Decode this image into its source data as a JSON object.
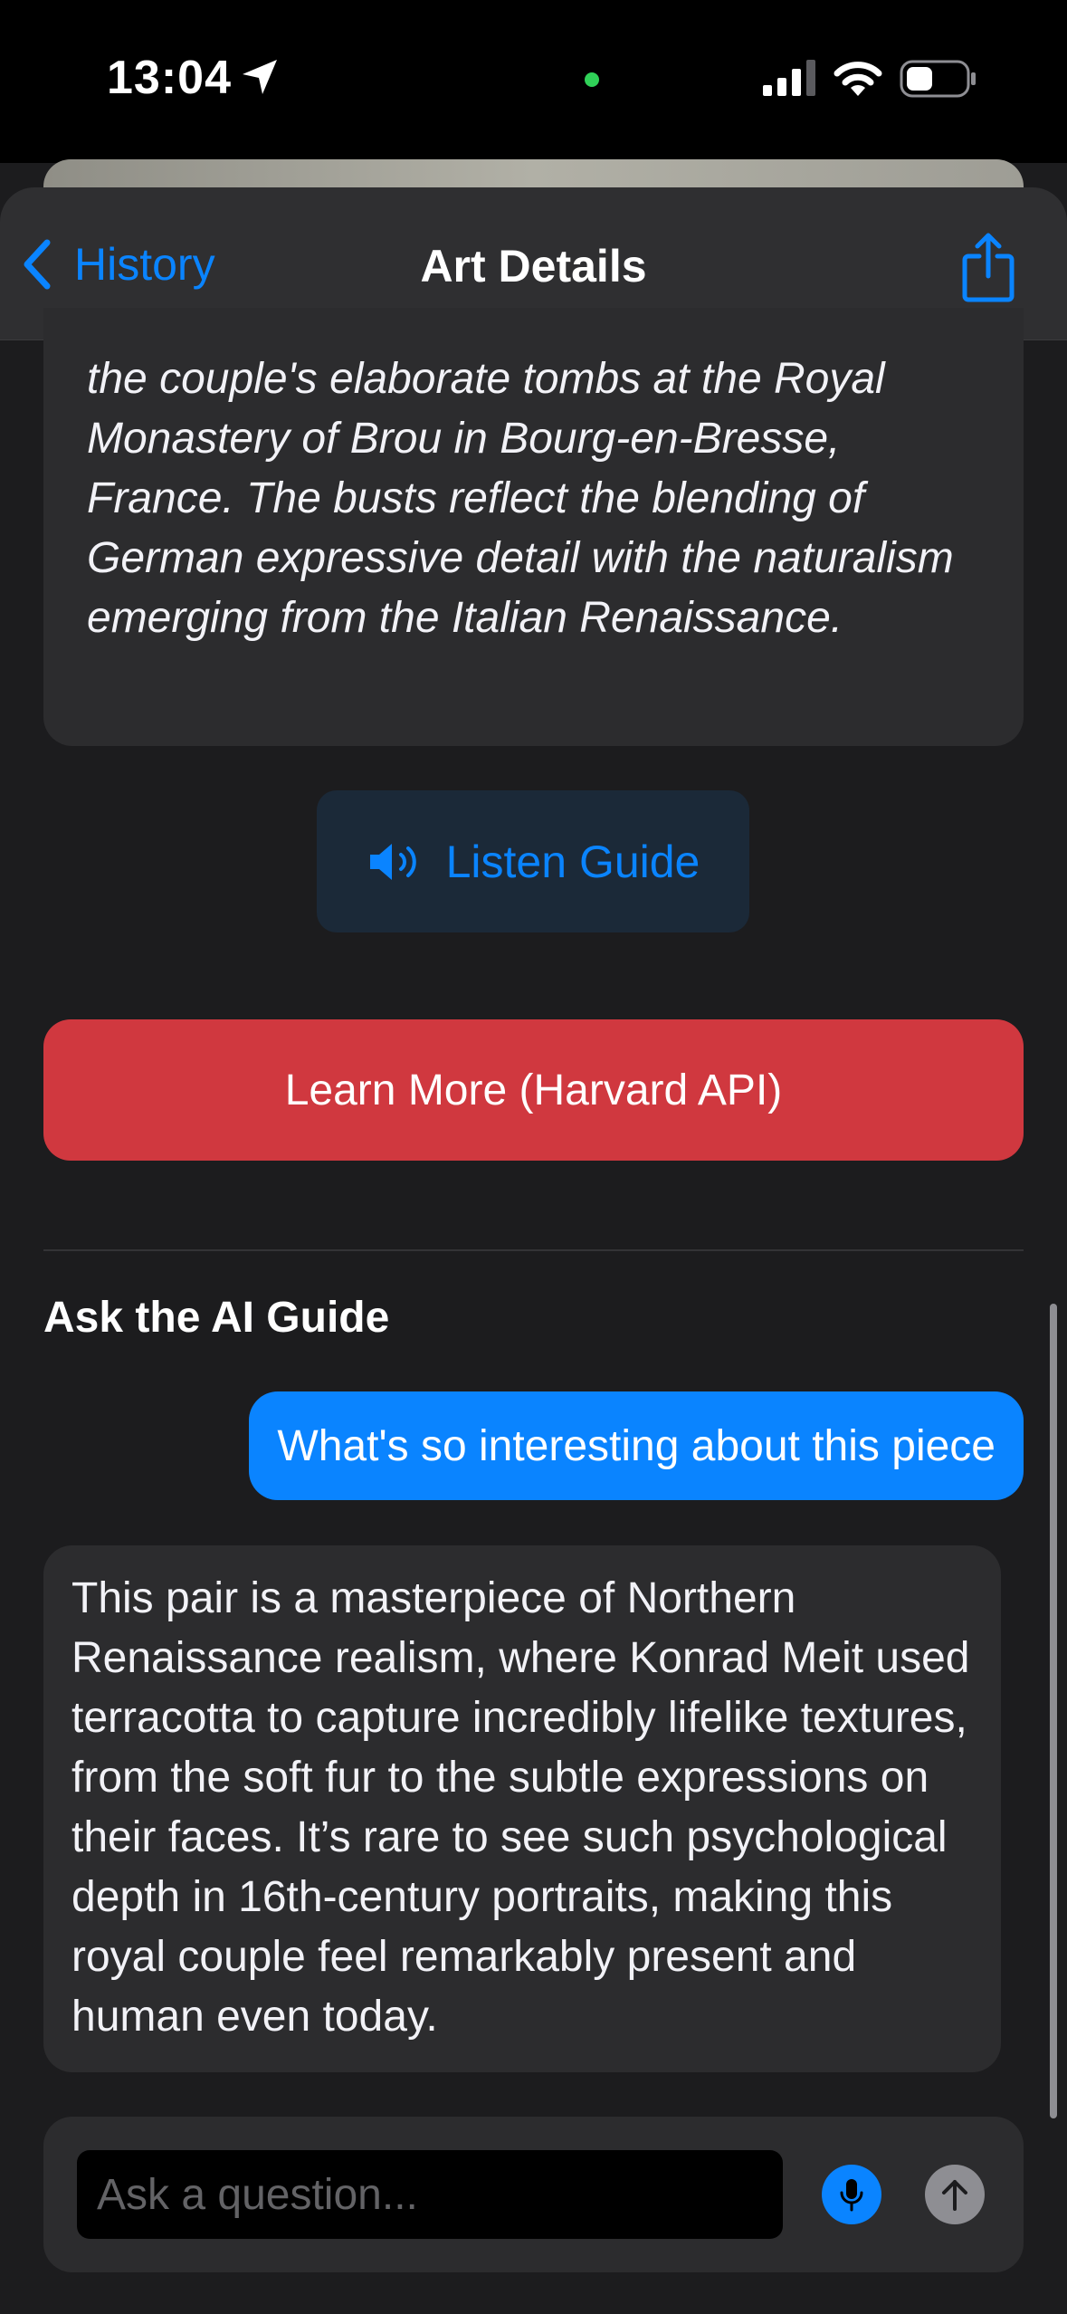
{
  "status_bar": {
    "time": "13:04",
    "location_icon": "location-arrow-icon",
    "signal_icon": "cellular-signal-icon",
    "wifi_icon": "wifi-icon",
    "battery_icon": "battery-icon",
    "recording_dot_color": "#30d158"
  },
  "nav": {
    "back_label": "History",
    "title": "Art Details",
    "share_icon": "share-icon"
  },
  "description": {
    "text": "the couple's elaborate tombs at the Royal Monastery of Brou in Bourg-en-Bresse, France. The busts reflect the blending of German expressive detail with the naturalism emerging from the Italian Renaissance."
  },
  "actions": {
    "listen_label": "Listen Guide",
    "learn_more_label": "Learn More (Harvard API)"
  },
  "chat": {
    "section_title": "Ask the AI Guide",
    "messages": [
      {
        "role": "user",
        "text": "What's so interesting about this piece"
      },
      {
        "role": "assistant",
        "text": "This pair is a masterpiece of Northern Renaissance realism, where Konrad Meit used terracotta to capture incredibly lifelike textures, from the soft fur to the subtle expressions on their faces. It’s rare to see such psychological depth in 16th-century portraits, making this royal couple feel remarkably present and human even today."
      }
    ],
    "input_placeholder": "Ask a question...",
    "input_value": ""
  },
  "colors": {
    "background": "#1c1c1e",
    "accent": "#0a84ff",
    "learn_more": "#d0383f",
    "card": "#2c2c2e"
  }
}
